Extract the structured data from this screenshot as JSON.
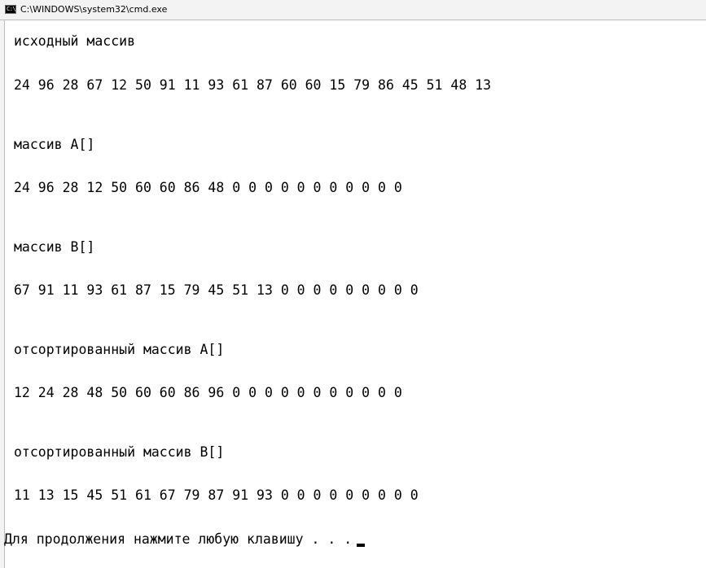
{
  "window": {
    "title": "C:\\WINDOWS\\system32\\cmd.exe",
    "icon_name": "cmd-icon",
    "icon_glyph": "C:\\"
  },
  "console": {
    "lines": [
      "исходный массив",
      "24 96 28 67 12 50 91 11 93 61 87 60 60 15 79 86 45 51 48 13",
      "массив A[]",
      "24 96 28 12 50 60 60 86 48 0 0 0 0 0 0 0 0 0 0 0",
      "массив B[]",
      "67 91 11 93 61 87 15 79 45 51 13 0 0 0 0 0 0 0 0 0",
      "отсортированный массив A[]",
      "12 24 28 48 50 60 60 86 96 0 0 0 0 0 0 0 0 0 0 0",
      "отсортированный массив B[]",
      "11 13 15 45 51 61 67 79 87 91 93 0 0 0 0 0 0 0 0 0"
    ],
    "prompt": "Для продолжения нажмите любую клавишу . . ."
  }
}
